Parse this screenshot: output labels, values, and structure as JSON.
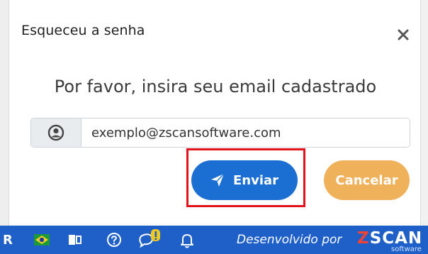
{
  "modal": {
    "title": "Esqueceu a senha",
    "prompt": "Por favor, insira seu email cadastrado",
    "email_value": "exemplo@zscansoftware.com",
    "send_label": "Enviar",
    "cancel_label": "Cancelar",
    "close_icon": "close-icon"
  },
  "taskbar": {
    "left_letter": "R",
    "developer_text": "Desenvolvido por",
    "logo_main": "SCAN",
    "logo_first": "Z",
    "logo_sub": "software"
  },
  "colors": {
    "primary": "#1c6fd2",
    "cancel": "#f0b15b",
    "highlight": "#e4101b",
    "taskbar": "#1f60c8"
  }
}
